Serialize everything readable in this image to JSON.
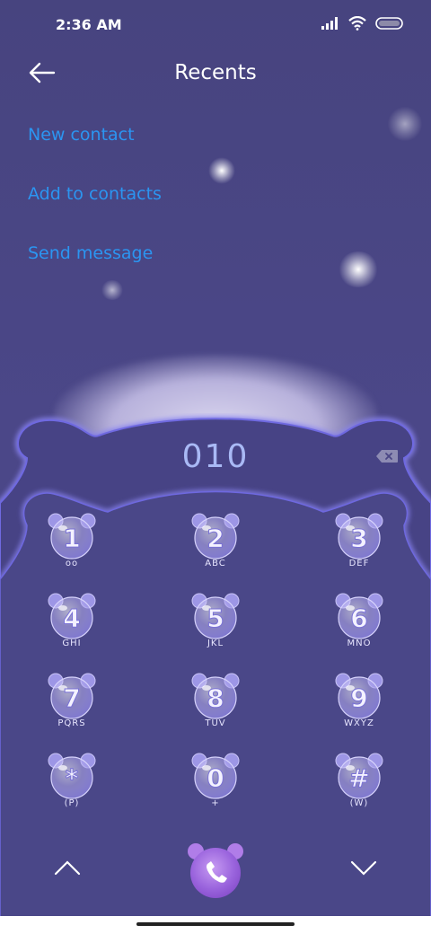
{
  "status": {
    "time": "2:36 AM"
  },
  "header": {
    "title": "Recents"
  },
  "actions": [
    "New contact",
    "Add to contacts",
    "Send message"
  ],
  "dialpad": {
    "number": "010",
    "keys": [
      {
        "digit": "1",
        "sub": "oo"
      },
      {
        "digit": "2",
        "sub": "ABC"
      },
      {
        "digit": "3",
        "sub": "DEF"
      },
      {
        "digit": "4",
        "sub": "GHI"
      },
      {
        "digit": "5",
        "sub": "JKL"
      },
      {
        "digit": "6",
        "sub": "MNO"
      },
      {
        "digit": "7",
        "sub": "PQRS"
      },
      {
        "digit": "8",
        "sub": "TUV"
      },
      {
        "digit": "9",
        "sub": "WXYZ"
      },
      {
        "digit": "*",
        "sub": "(P)"
      },
      {
        "digit": "0",
        "sub": "+"
      },
      {
        "digit": "#",
        "sub": "(W)"
      }
    ]
  },
  "colors": {
    "background": "#4a4685",
    "link": "#2b95f1",
    "number": "#a9b9f5"
  }
}
